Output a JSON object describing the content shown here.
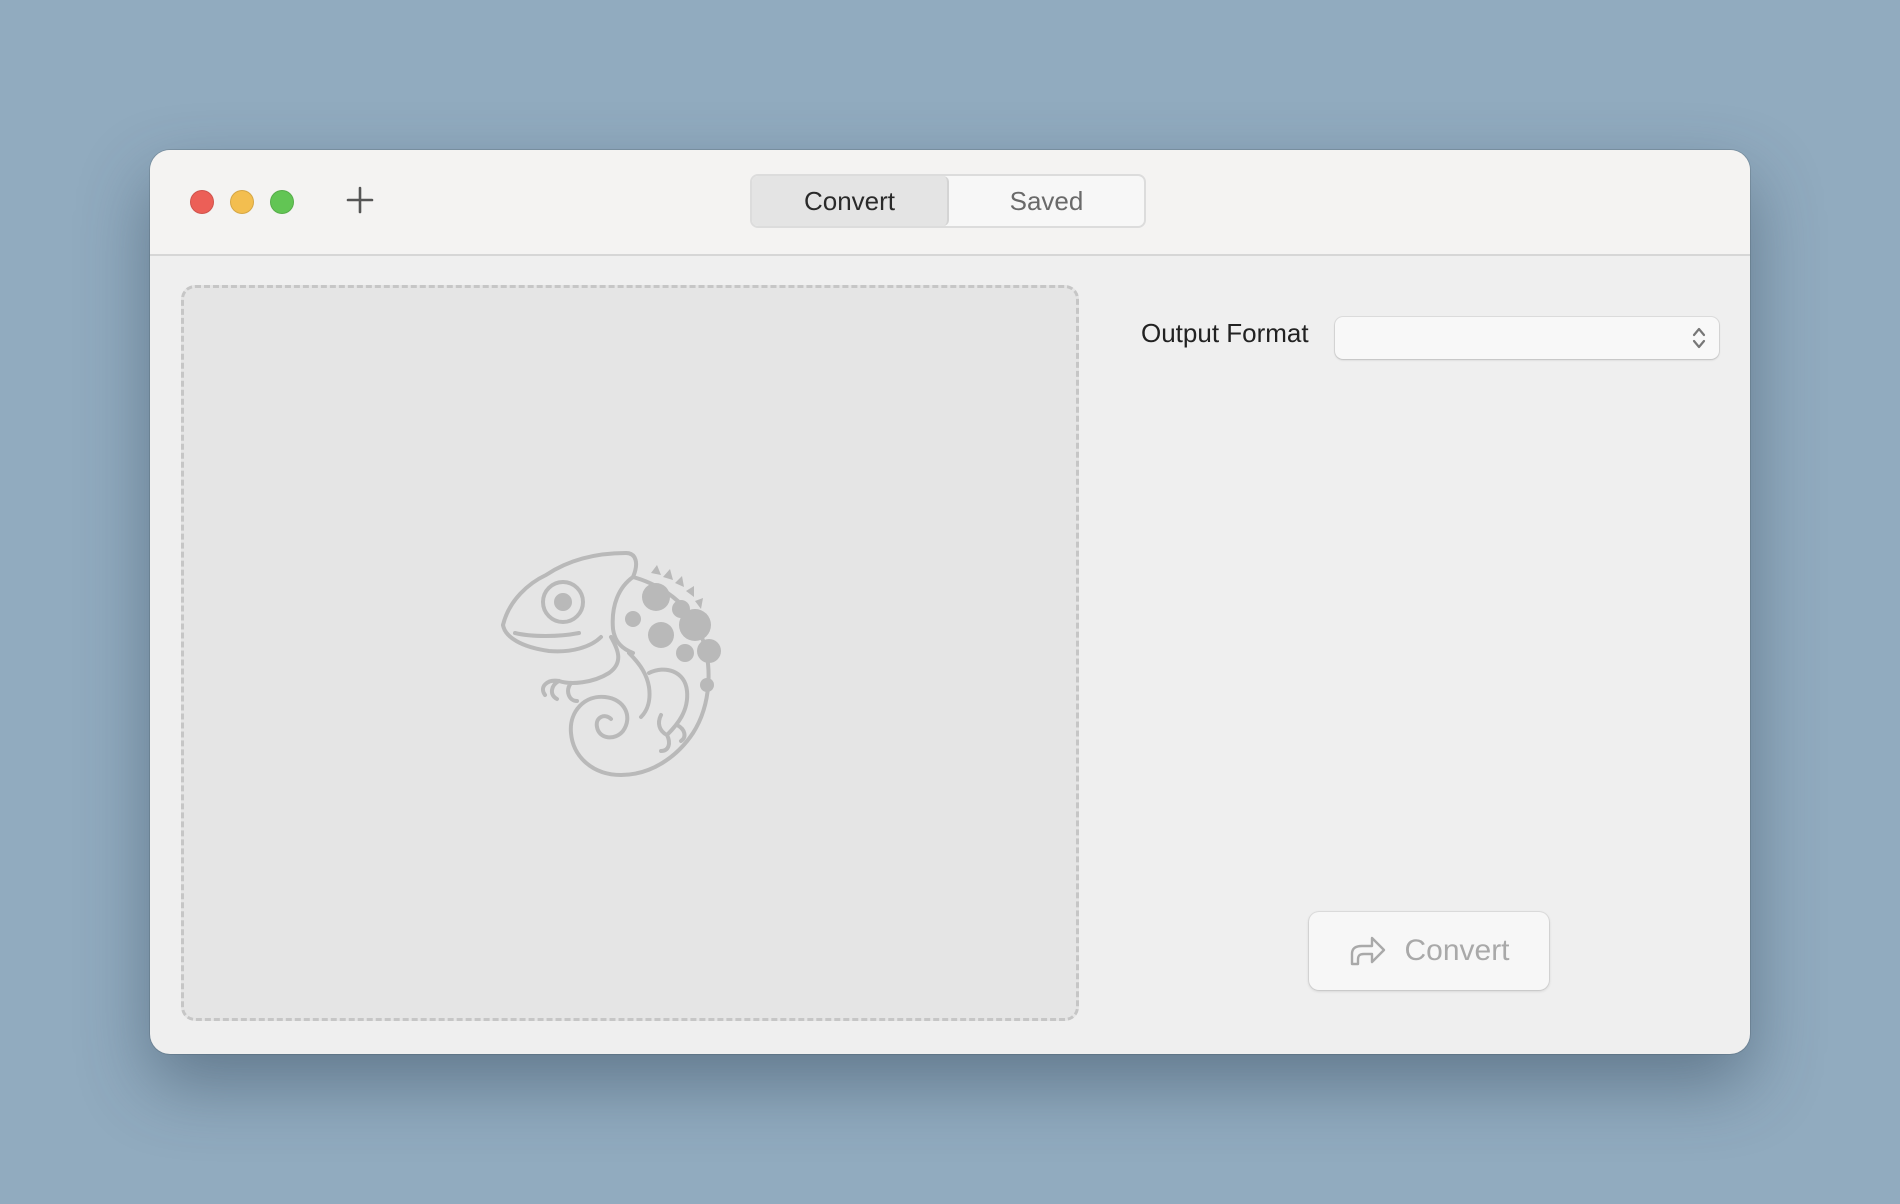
{
  "window": {
    "tabs": [
      {
        "label": "Convert",
        "active": true
      },
      {
        "label": "Saved",
        "active": false
      }
    ]
  },
  "icons": {
    "close": "close-window-icon",
    "minimize": "minimize-window-icon",
    "maximize": "maximize-window-icon",
    "add": "plus-icon",
    "dropzone_illustration": "chameleon-icon",
    "select_arrows": "chevron-up-down-icon",
    "convert": "share-arrow-icon"
  },
  "sidebar": {
    "output_format_label": "Output Format",
    "output_format_value": ""
  },
  "actions": {
    "convert_label": "Convert",
    "convert_enabled": false
  },
  "colors": {
    "background": "#91abbf",
    "traffic_close": "#ec5f57",
    "traffic_minimize": "#f3be4f",
    "traffic_maximize": "#62c554",
    "disabled_text": "#a9a9a9"
  }
}
